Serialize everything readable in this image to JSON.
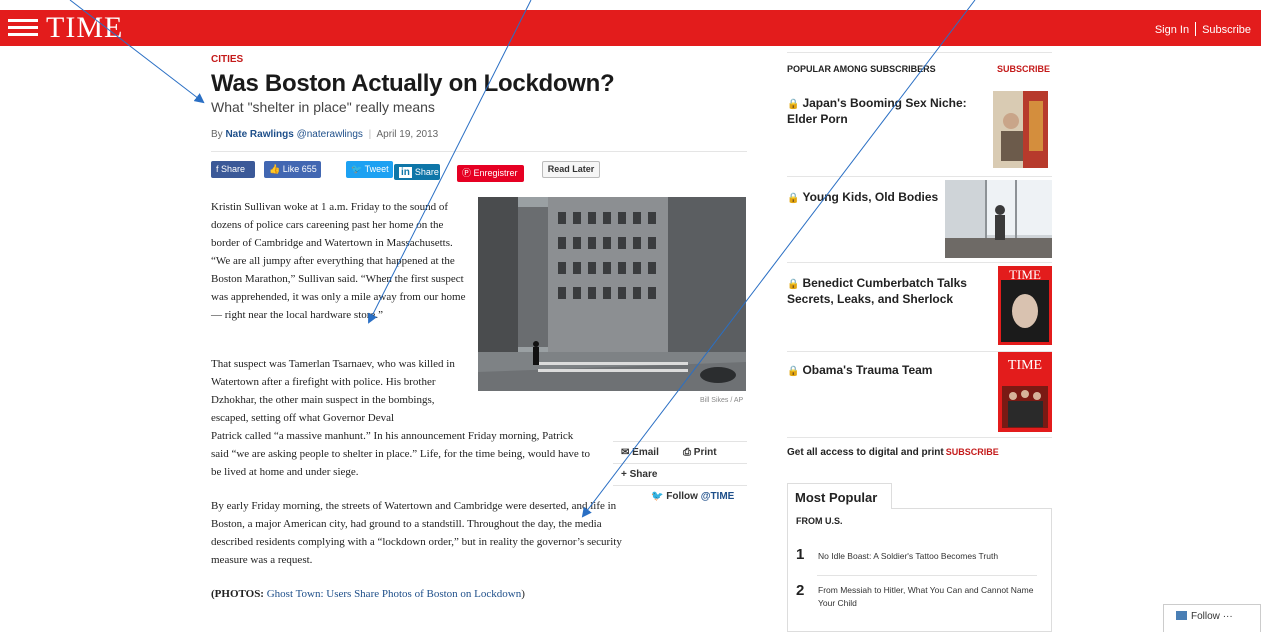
{
  "header": {
    "logo": "TIME",
    "sign_in": "Sign In",
    "subscribe": "Subscribe"
  },
  "article": {
    "kicker": "CITIES",
    "headline": "Was Boston Actually on Lockdown?",
    "dek": "What \"shelter in place\" really means",
    "byline_prefix": "By",
    "author": "Nate Rawlings",
    "handle": "@naterawlings",
    "date": "April 19, 2013",
    "share": {
      "facebook_share": "f Share",
      "facebook_like": "Like 655",
      "tweet": "Tweet",
      "linkedin_share": "Share",
      "linkedin_logo": "in",
      "pinterest": "Enregistrer",
      "read_later": "Read Later"
    },
    "p1": "Kristin Sullivan woke at 1 a.m. Friday to the sound of dozens of police cars careening past her home on the border of Cambridge and Watertown in Massachusetts. “We are all jumpy after everything that happened at the Boston Marathon,” Sullivan said. “When the first suspect was apprehended, it was only a mile away from our home — right near the local hardware store.”",
    "p2a": "That suspect was Tamerlan Tsarnaev, who was killed in Watertown after a firefight with police. His brother Dzhokhar, the other main suspect in the bombings, escaped, setting off what Governor Deval",
    "p2b": "Patrick called “a massive manhunt.” In his announcement Friday morning, Patrick said “we are asking people to shelter in place.” Life, for the time being, would have to be lived at home and under siege.",
    "p3": "By early Friday morning, the streets of Watertown and Cambridge were deserted, and life in Boston, a major American city, had ground to a standstill. Throughout the day, the media described residents complying with a “lockdown order,” but in reality the governor’s security measure was a request.",
    "p4_lead": "(PHOTOS:",
    "p4_link": "Ghost Town: Users Share Photos of Boston on Lockdown",
    "p4_end": ")",
    "photo_credit": "Bill Sikes / AP",
    "tools": {
      "email": "Email",
      "print": "Print",
      "share": "+ Share",
      "follow": "Follow",
      "follow_handle": "@TIME"
    }
  },
  "sidebar": {
    "popular_heading": "POPULAR AMONG SUBSCRIBERS",
    "subscribe_link": "SUBSCRIBE",
    "stories": [
      {
        "title": "Japan's Booming Sex Niche: Elder Porn"
      },
      {
        "title": "Young Kids, Old Bodies"
      },
      {
        "title": "Benedict Cumberbatch Talks Secrets, Leaks, and Sherlock"
      },
      {
        "title": "Obama's Trauma Team"
      }
    ],
    "cover_logo": "TIME",
    "access_text": "Get all access to digital and print",
    "access_subscribe": "SUBSCRIBE",
    "most_popular": {
      "tab": "Most Popular",
      "from": "FROM U.S.",
      "items": [
        {
          "n": "1",
          "title": "No Idle Boast: A Soldier's Tattoo Becomes Truth"
        },
        {
          "n": "2",
          "title": "From Messiah to Hitler, What You Can and Cannot Name Your Child"
        }
      ]
    }
  },
  "follow_widget": {
    "label": "Follow",
    "more": "···"
  },
  "colors": {
    "brand_red": "#e31c1c",
    "link_blue": "#1e4f8a",
    "arrow_blue": "#2a6fc4"
  }
}
